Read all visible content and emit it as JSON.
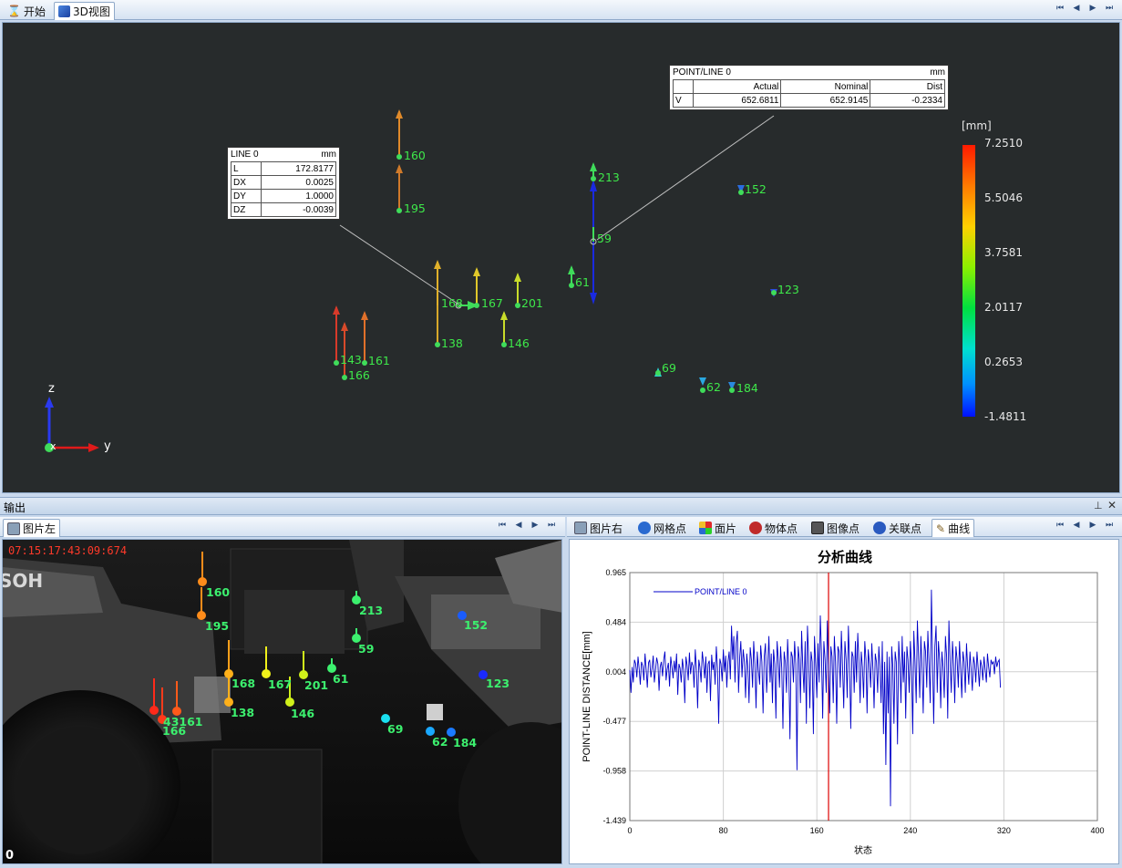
{
  "top_tabs": [
    {
      "label": "开始",
      "icon": "hourglass-icon"
    },
    {
      "label": "3D视图",
      "icon": "cube-icon"
    }
  ],
  "view3d": {
    "axes": {
      "z": "z",
      "x": "x",
      "y": "y"
    },
    "line_box": {
      "title": "LINE 0",
      "unit": "mm",
      "rows": [
        {
          "key": "L",
          "value": "172.8177"
        },
        {
          "key": "DX",
          "value": "0.0025"
        },
        {
          "key": "DY",
          "value": "1.0000"
        },
        {
          "key": "DZ",
          "value": "-0.0039"
        }
      ]
    },
    "pointline_box": {
      "title": "POINT/LINE 0",
      "unit": "mm",
      "headers": [
        "Actual",
        "Nominal",
        "Dist"
      ],
      "row_key": "V",
      "values": [
        "652.6811",
        "652.9145",
        "-0.2334"
      ]
    },
    "colorbar": {
      "unit": "[mm]",
      "ticks": [
        "7.2510",
        "5.5046",
        "3.7581",
        "2.0117",
        "0.2653",
        "-1.4811"
      ]
    },
    "points": [
      {
        "id": "160",
        "color": "#e08a2a"
      },
      {
        "id": "195",
        "color": "#e08a2a"
      },
      {
        "id": "213",
        "color": "#3fdc5a"
      },
      {
        "id": "59",
        "color": "#3fdc5a"
      },
      {
        "id": "152",
        "color": "#2a6de0"
      },
      {
        "id": "168",
        "color": "#e0b02a"
      },
      {
        "id": "167",
        "color": "#e0c82a"
      },
      {
        "id": "201",
        "color": "#c8dc2a"
      },
      {
        "id": "61",
        "color": "#3fdc5a"
      },
      {
        "id": "123",
        "color": "#2a4ae0"
      },
      {
        "id": "143",
        "color": "#d83a2a"
      },
      {
        "id": "161",
        "color": "#e0702a"
      },
      {
        "id": "166",
        "color": "#d83a2a"
      },
      {
        "id": "138",
        "color": "#e0b02a"
      },
      {
        "id": "146",
        "color": "#c8dc2a"
      },
      {
        "id": "69",
        "color": "#2ad0c8"
      },
      {
        "id": "62",
        "color": "#2aa8e0"
      },
      {
        "id": "184",
        "color": "#2a8ae0"
      }
    ]
  },
  "output_panel": {
    "title": "输出"
  },
  "left_tab": {
    "label": "图片左"
  },
  "image_left": {
    "timestamp": "07:15:17:43:09:674",
    "frame": "0",
    "sign_text": "SOH",
    "points": [
      "160",
      "195",
      "213",
      "152",
      "59",
      "168",
      "167",
      "201",
      "61",
      "123",
      "138",
      "146",
      "43161",
      "166",
      "69",
      "62",
      "184"
    ]
  },
  "right_tabs": [
    {
      "label": "图片右",
      "icon": "image-icon"
    },
    {
      "label": "网格点",
      "icon": "grid-points-icon"
    },
    {
      "label": "面片",
      "icon": "patch-icon"
    },
    {
      "label": "物体点",
      "icon": "object-points-icon"
    },
    {
      "label": "图像点",
      "icon": "image-points-icon"
    },
    {
      "label": "关联点",
      "icon": "linked-points-icon"
    },
    {
      "label": "曲线",
      "icon": "curve-icon"
    }
  ],
  "chart_data": {
    "type": "line",
    "title": "分析曲线",
    "xlabel": "状态",
    "ylabel": "POINT-LINE DISTANCE[mm]",
    "xlim": [
      0,
      400
    ],
    "ylim": [
      -1.439,
      0.965
    ],
    "x_ticks": [
      "0",
      "80",
      "160",
      "240",
      "320",
      "400"
    ],
    "y_ticks": [
      "0.965",
      "0.484",
      "0.004",
      "-0.477",
      "-0.958",
      "-1.439"
    ],
    "grid": true,
    "legend": "top-left",
    "marker_x": 170,
    "series": [
      {
        "name": "POINT/LINE 0",
        "color": "#0000c8",
        "x_start": 0,
        "x_step": 1,
        "values": [
          0.02,
          -0.2,
          0.05,
          -0.1,
          0.12,
          0.08,
          -0.05,
          0.15,
          0.03,
          -0.12,
          0.1,
          0.06,
          -0.08,
          0.18,
          0.02,
          -0.15,
          0.09,
          0.12,
          -0.05,
          0.04,
          0.16,
          -0.1,
          0.02,
          0.14,
          0.08,
          -0.18,
          0.05,
          0.1,
          -0.04,
          0.12,
          0.2,
          -0.08,
          0.03,
          0.09,
          -0.14,
          0.15,
          0.05,
          -0.06,
          0.11,
          0.0,
          0.18,
          -0.22,
          0.08,
          0.04,
          -0.1,
          0.13,
          0.02,
          -0.3,
          0.15,
          0.07,
          -0.08,
          0.19,
          -0.02,
          0.1,
          0.06,
          -0.15,
          0.22,
          0.03,
          -0.35,
          0.12,
          0.05,
          -0.1,
          0.2,
          0.09,
          -0.06,
          0.15,
          -0.2,
          0.08,
          0.11,
          -0.28,
          0.17,
          0.02,
          0.1,
          -0.12,
          0.25,
          0.04,
          -0.5,
          0.13,
          0.08,
          -0.09,
          0.22,
          0.0,
          0.16,
          -0.15,
          0.1,
          0.2,
          -0.07,
          0.45,
          0.12,
          0.35,
          -0.1,
          0.28,
          0.4,
          -0.2,
          0.15,
          0.3,
          -0.05,
          0.22,
          0.1,
          -0.25,
          0.18,
          0.05,
          -0.3,
          0.24,
          0.12,
          -0.15,
          0.3,
          0.08,
          -0.35,
          0.2,
          0.02,
          -0.12,
          0.26,
          0.1,
          -0.4,
          0.15,
          0.28,
          -0.2,
          0.05,
          0.35,
          -0.1,
          0.18,
          -0.3,
          0.22,
          0.08,
          -0.45,
          0.3,
          0.12,
          -0.15,
          0.25,
          0.04,
          -0.55,
          0.2,
          0.1,
          -0.2,
          0.32,
          0.05,
          -0.65,
          0.2,
          0.15,
          -0.1,
          0.3,
          0.08,
          -0.95,
          0.25,
          0.12,
          -0.3,
          0.4,
          0.05,
          -0.2,
          0.3,
          -0.5,
          0.45,
          0.15,
          -0.35,
          0.2,
          0.1,
          -0.6,
          0.35,
          0.08,
          -0.25,
          0.28,
          -0.1,
          0.55,
          0.18,
          -0.45,
          0.3,
          0.12,
          -0.2,
          0.5,
          0.05,
          -0.4,
          0.25,
          0.15,
          -0.3,
          0.35,
          0.1,
          -0.5,
          0.25,
          0.2,
          -0.15,
          0.4,
          0.05,
          -0.35,
          0.3,
          0.12,
          -0.25,
          0.45,
          0.08,
          -0.55,
          0.2,
          0.15,
          -0.2,
          0.3,
          -0.1,
          0.38,
          0.1,
          -0.3,
          0.2,
          0.05,
          -0.25,
          0.3,
          0.12,
          -0.4,
          0.22,
          0.08,
          -0.15,
          0.28,
          0.02,
          -0.35,
          0.18,
          0.1,
          -0.2,
          0.25,
          0.05,
          -0.3,
          0.3,
          -0.6,
          0.1,
          -0.9,
          0.2,
          -0.4,
          0.15,
          -1.3,
          0.25,
          0.05,
          -0.5,
          0.2,
          0.1,
          -0.7,
          0.3,
          0.08,
          -0.3,
          0.35,
          -0.1,
          0.2,
          -0.45,
          0.25,
          0.12,
          -0.2,
          0.3,
          0.05,
          -0.6,
          0.4,
          0.1,
          -0.3,
          0.5,
          0.15,
          -0.25,
          0.35,
          0.05,
          -0.4,
          0.3,
          0.2,
          -0.15,
          0.4,
          0.08,
          -0.3,
          0.8,
          0.1,
          -0.5,
          0.25,
          0.45,
          -0.2,
          0.3,
          0.12,
          -0.35,
          0.2,
          0.05,
          -0.25,
          0.35,
          0.15,
          -0.45,
          0.5,
          0.1,
          -0.2,
          0.3,
          0.08,
          -0.3,
          0.25,
          0.12,
          -0.15,
          0.3,
          0.05,
          -0.25,
          0.2,
          0.1,
          -0.2,
          0.28,
          0.06,
          -0.12,
          0.2,
          0.02,
          -0.18,
          0.15,
          0.08,
          -0.1,
          0.2,
          0.04,
          -0.14,
          0.12,
          0.06,
          -0.08,
          0.15,
          0.02,
          -0.1,
          0.18,
          0.05,
          -0.05,
          0.12,
          0.08,
          0.1,
          -0.02,
          0.15,
          0.05,
          0.1,
          0.12,
          -0.15
        ]
      }
    ]
  }
}
